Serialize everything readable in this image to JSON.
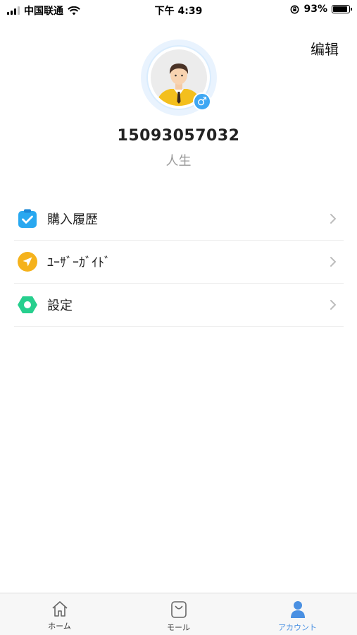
{
  "status_bar": {
    "carrier": "中国联通",
    "time": "下午 4:39",
    "battery": "93%",
    "battery_level": 0.93
  },
  "header": {
    "edit_label": "编辑"
  },
  "profile": {
    "phone": "15093057032",
    "nickname": "人生",
    "gender_icon": "male-icon"
  },
  "menu": {
    "items": [
      {
        "label": "購入履歴",
        "icon": "clipboard-check-icon",
        "color": "#29a8f0"
      },
      {
        "label": "ﾕｰｻﾞｰｶﾞｲﾄﾞ",
        "icon": "navigation-arrow-icon",
        "color": "#f5b21c"
      },
      {
        "label": "設定",
        "icon": "hexagon-settings-icon",
        "color": "#27cf8e"
      }
    ]
  },
  "tabbar": {
    "items": [
      {
        "label": "ホーム",
        "icon": "home-icon"
      },
      {
        "label": "モール",
        "icon": "shopping-bag-icon"
      },
      {
        "label": "アカウント",
        "icon": "user-icon",
        "active": true
      }
    ],
    "active_color": "#4a90e2"
  }
}
